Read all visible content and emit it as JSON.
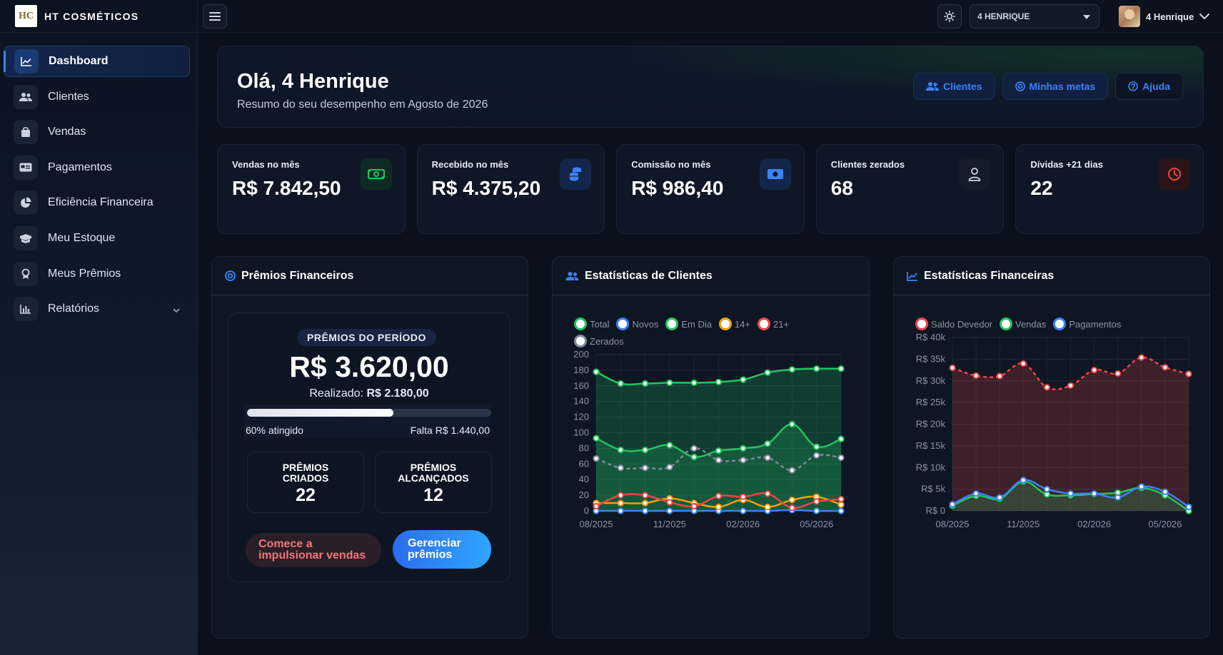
{
  "brand": {
    "logo_text": "HC",
    "name": "HT COSMÉTICOS"
  },
  "nav": [
    {
      "label": "Dashboard",
      "icon": "chart-line-icon",
      "active": true
    },
    {
      "label": "Clientes",
      "icon": "users-icon"
    },
    {
      "label": "Vendas",
      "icon": "shopping-bag-icon"
    },
    {
      "label": "Pagamentos",
      "icon": "card-icon"
    },
    {
      "label": "Eficiência Financeira",
      "icon": "pie-chart-icon"
    },
    {
      "label": "Meu Estoque",
      "icon": "box-icon"
    },
    {
      "label": "Meus Prêmios",
      "icon": "award-icon"
    },
    {
      "label": "Relatórios",
      "icon": "bar-chart-icon",
      "expandable": true
    }
  ],
  "topbar": {
    "user_select": "4 HENRIQUE",
    "profile_name": "4 Henrique"
  },
  "hero": {
    "title": "Olá, 4 Henrique",
    "subtitle": "Resumo do seu desempenho em Agosto de 2026",
    "buttons": {
      "clientes": "Clientes",
      "metas": "Minhas metas",
      "ajuda": "Ajuda"
    }
  },
  "kpis": [
    {
      "label": "Vendas no mês",
      "value": "R$ 7.842,50",
      "icon": "money-icon",
      "color": "#22c55e"
    },
    {
      "label": "Recebido no mês",
      "value": "R$ 4.375,20",
      "icon": "coins-icon",
      "color": "#3b82f6"
    },
    {
      "label": "Comissão no mês",
      "value": "R$ 986,40",
      "icon": "cash-icon",
      "color": "#3b82f6"
    },
    {
      "label": "Clientes zerados",
      "value": "68",
      "icon": "user-icon",
      "color": "#cbd5e1"
    },
    {
      "label": "Dívidas +21 dias",
      "value": "22",
      "icon": "clock-icon",
      "color": "#ef4444"
    }
  ],
  "prizes": {
    "title": "Prêmios Financeiros",
    "tag": "PRÊMIOS DO PERÍODO",
    "total": "R$ 3.620,00",
    "realized_label": "Realizado:",
    "realized_value": "R$ 2.180,00",
    "progress": 0.6,
    "progress_label": "60% atingido",
    "remaining": "Falta R$ 1.440,00",
    "created_label": [
      "PRÊMIOS",
      "CRIADOS"
    ],
    "created_value": "22",
    "reached_label": [
      "PRÊMIOS",
      "ALCANÇADOS"
    ],
    "reached_value": "12",
    "boost_button": [
      "Comece a",
      "impulsionar vendas"
    ],
    "manage_button": [
      "Gerenciar",
      "prêmios"
    ]
  },
  "client_stats": {
    "title": "Estatísticas de Clientes",
    "chart_data": {
      "type": "line",
      "x": [
        "08/2025",
        "09/2025",
        "10/2025",
        "11/2025",
        "12/2025",
        "01/2026",
        "02/2026",
        "03/2026",
        "04/2026",
        "05/2026",
        "06/2026"
      ],
      "x_tick_labels": [
        "08/2025",
        "11/2025",
        "02/2026",
        "05/2026"
      ],
      "ylim": [
        0,
        200
      ],
      "y_ticks": [
        0,
        20,
        40,
        60,
        80,
        100,
        120,
        140,
        160,
        180,
        200
      ],
      "series": [
        {
          "name": "Total",
          "color": "#22c55e",
          "fill": true,
          "values": [
            178,
            163,
            163,
            164,
            164,
            165,
            168,
            177,
            181,
            182,
            182
          ]
        },
        {
          "name": "Novos",
          "color": "#3b82f6",
          "values": [
            0,
            0,
            0,
            0,
            0,
            0,
            0,
            0,
            1,
            0,
            0
          ]
        },
        {
          "name": "Em Dia",
          "color": "#22c55e",
          "fill": true,
          "values": [
            93,
            78,
            78,
            84,
            69,
            77,
            80,
            86,
            111,
            82,
            92
          ]
        },
        {
          "name": "14+",
          "color": "#f59e0b",
          "values": [
            10,
            10,
            10,
            16,
            10,
            5,
            14,
            5,
            14,
            18,
            8
          ]
        },
        {
          "name": "21+",
          "color": "#ef4444",
          "values": [
            6,
            20,
            20,
            11,
            6,
            19,
            18,
            22,
            4,
            12,
            15
          ]
        },
        {
          "name": "Zerados",
          "color": "#7f8a9c",
          "dashed": true,
          "values": [
            67,
            55,
            55,
            56,
            80,
            65,
            65,
            68,
            52,
            71,
            68
          ]
        }
      ]
    }
  },
  "fin_stats": {
    "title": "Estatísticas Financeiras",
    "chart_data": {
      "type": "line",
      "x": [
        "08/2025",
        "09/2025",
        "10/2025",
        "11/2025",
        "12/2025",
        "01/2026",
        "02/2026",
        "03/2026",
        "04/2026",
        "05/2026",
        "06/2026"
      ],
      "x_tick_labels": [
        "08/2025",
        "11/2025",
        "02/2026",
        "05/2026"
      ],
      "ylim": [
        0,
        40000
      ],
      "y_tick_labels": [
        "R$ 0",
        "R$ 5k",
        "R$ 10k",
        "R$ 15k",
        "R$ 20k",
        "R$ 25k",
        "R$ 30k",
        "R$ 35k",
        "R$ 40k"
      ],
      "series": [
        {
          "name": "Saldo Devedor",
          "color": "#ef4444",
          "dashed": true,
          "fill": true,
          "values": [
            33000,
            31200,
            31100,
            34000,
            28500,
            28900,
            32500,
            31700,
            35400,
            33100,
            31600
          ]
        },
        {
          "name": "Vendas",
          "color": "#22c55e",
          "fill": true,
          "values": [
            1200,
            3500,
            2800,
            6800,
            3800,
            3600,
            3900,
            4200,
            5300,
            3600,
            0
          ]
        },
        {
          "name": "Pagamentos",
          "color": "#3b82f6",
          "values": [
            1500,
            4000,
            3100,
            7100,
            5000,
            4000,
            4000,
            3100,
            5600,
            4400,
            900
          ]
        }
      ]
    }
  }
}
